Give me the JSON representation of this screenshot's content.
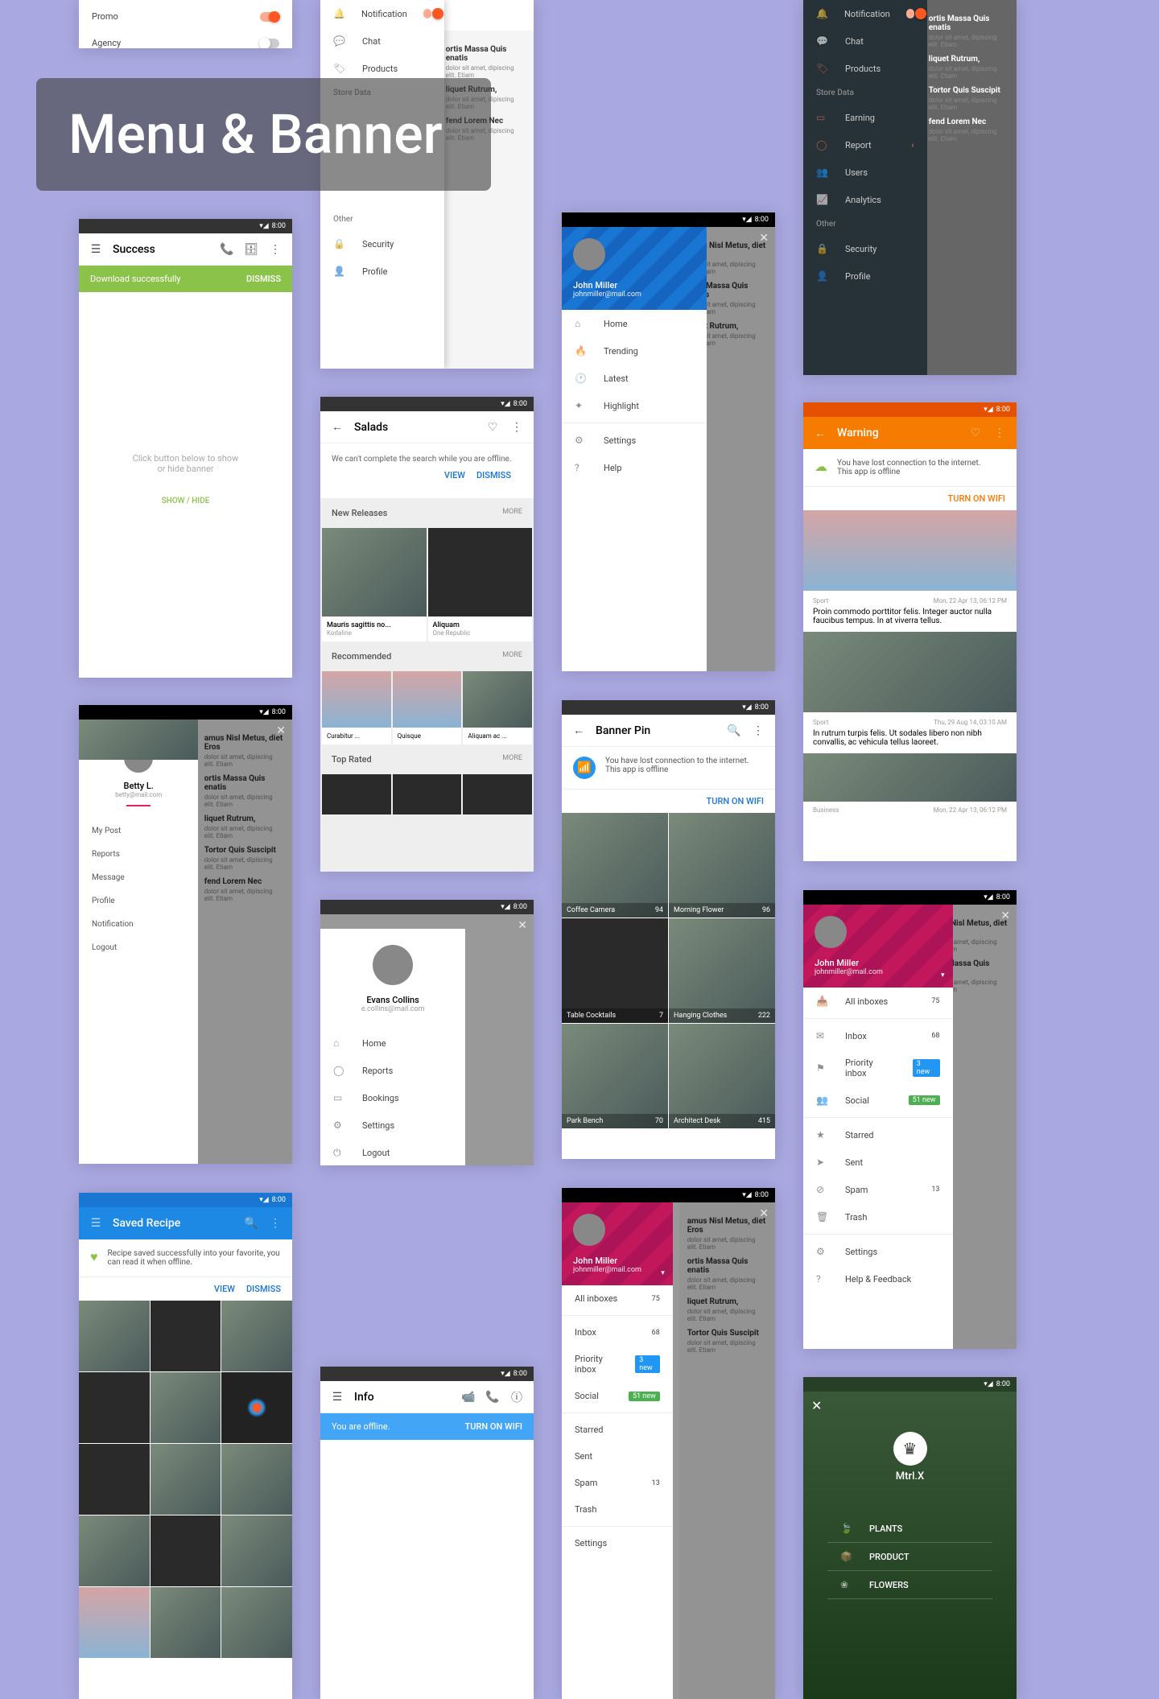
{
  "page_title": "Menu & Banner",
  "status": {
    "time": "8:00"
  },
  "s1": {
    "items": [
      "Promo",
      "Agency"
    ]
  },
  "s2": {
    "title": "Success",
    "banner": "Download successfully",
    "dismiss": "DISMISS",
    "hint1": "Click button below to show",
    "hint2": "or hide banner",
    "action": "SHOW / HIDE"
  },
  "s3": {
    "notif": "Notification",
    "chat": "Chat",
    "products": "Products",
    "store": "Store Data",
    "other": "Other",
    "security": "Security",
    "profile": "Profile"
  },
  "s4": {
    "title": "Salads",
    "banner": "We can't complete the search while you are offline.",
    "view": "VIEW",
    "dismiss": "DISMISS",
    "sec1": "New Releases",
    "sec2": "Recommended",
    "sec3": "Top Rated",
    "more": "MORE",
    "card1": "Mauris sagittis no...",
    "sub1": "Kodaline",
    "card2": "Aliquam",
    "sub2": "One Republic",
    "r1": "Curabitur ...",
    "r2": "Quisque",
    "r3": "Aliquam ac ..."
  },
  "s5": {
    "name": "John Miller",
    "email": "johnmiller@mail.com",
    "m1": "Home",
    "m2": "Trending",
    "m3": "Latest",
    "m4": "Highlight",
    "m5": "Settings",
    "m6": "Help"
  },
  "s6": {
    "name": "Betty L.",
    "email": "betty@mail.com",
    "m1": "My Post",
    "m2": "Reports",
    "m3": "Message",
    "m4": "Profile",
    "m5": "Notification",
    "m6": "Logout"
  },
  "s7": {
    "name": "Evans Collins",
    "email": "e.collins@mail.com",
    "m1": "Home",
    "m2": "Reports",
    "m3": "Bookings",
    "m4": "Settings",
    "m5": "Logout"
  },
  "s8": {
    "title": "Banner Pin",
    "msg1": "You have lost connection to the internet.",
    "msg2": "This app is offline",
    "action": "TURN ON WIFI",
    "g1": "Coffee Camera",
    "c1": "94",
    "g2": "Morning Flower",
    "c2": "96",
    "g3": "Table Cocktails",
    "c3": "7",
    "g4": "Hanging Clothes",
    "c4": "222",
    "g5": "Park Bench",
    "c5": "70",
    "g6": "Architect Desk",
    "c6": "415"
  },
  "s9": {
    "title": "Saved Recipe",
    "msg": "Recipe saved successfully into your favorite, you can read it when offline.",
    "view": "VIEW",
    "dismiss": "DISMISS"
  },
  "s10": {
    "title": "Info",
    "banner": "You are offline.",
    "action": "TURN ON WIFI"
  },
  "s11": {
    "name": "John Miller",
    "email": "johnmiller@mail.com",
    "m1": "All inboxes",
    "v1": "75",
    "m2": "Inbox",
    "v2": "68",
    "m3": "Priority inbox",
    "b3": "3 new",
    "m4": "Social",
    "b4": "51 new",
    "m5": "Starred",
    "m6": "Sent",
    "m7": "Spam",
    "v7": "13",
    "m8": "Trash",
    "m9": "Settings"
  },
  "s12": {
    "title": "Warning",
    "msg1": "You have lost connection to the internet.",
    "msg2": "This app is offline",
    "action": "TURN ON WIFI",
    "cat": "Sport",
    "date1": "Mon, 22 Apr 13, 06:12 PM",
    "t1": "Proin commodo porttitor felis. Integer auctor nulla faucibus tempus. In at viverra tellus.",
    "date2": "Thu, 29 Aug 14, 03:10 AM",
    "t2": "In rutrum turpis felis. Ut sodales libero non nibh convallis, ac vehicula tellus laoreet.",
    "cat3": "Business",
    "date3": "Mon, 22 Apr 13, 06:12 PM"
  },
  "s13": {
    "name": "John Miller",
    "email": "johnmiller@mail.com",
    "m1": "All inboxes",
    "v1": "75",
    "m2": "Inbox",
    "v2": "68",
    "m3": "Priority inbox",
    "b3": "3 new",
    "m4": "Social",
    "b4": "51 new",
    "m5": "Starred",
    "m6": "Sent",
    "m7": "Spam",
    "v7": "13",
    "m8": "Trash",
    "m9": "Settings",
    "m10": "Help & Feedback"
  },
  "s14": {
    "notif": "Notification",
    "chat": "Chat",
    "products": "Products",
    "store": "Store Data",
    "earning": "Earning",
    "report": "Report",
    "users": "Users",
    "analytics": "Analytics",
    "other": "Other",
    "security": "Security",
    "profile": "Profile"
  },
  "s15": {
    "brand": "Mtrl.X",
    "m1": "PLANTS",
    "m2": "PRODUCT",
    "m3": "FLOWERS"
  },
  "content": {
    "h1": "amus Nisl Metus, diet Eros",
    "p1": "dolor sit amet, dipiscing elit. Etiam",
    "h2": "ortis Massa Quis enatis",
    "h3": "liquet Rutrum,",
    "h4": "Tortor Quis Suscipit",
    "h5": "fend Lorem Nec"
  }
}
